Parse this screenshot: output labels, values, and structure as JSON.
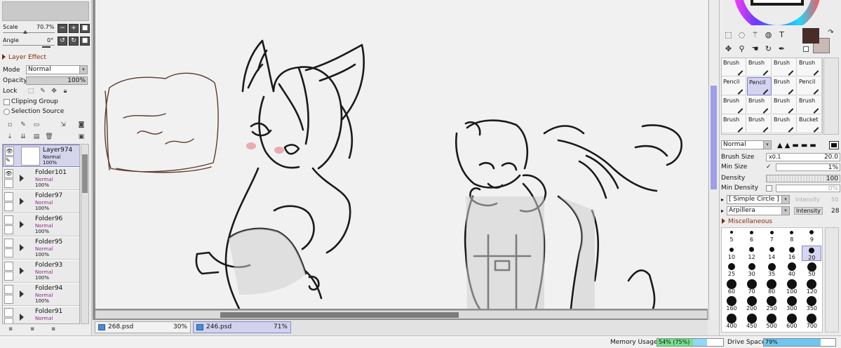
{
  "navigator": {
    "scale_label": "Scale",
    "scale_value": "70.7%",
    "angle_label": "Angle",
    "angle_value": "0°",
    "zoom_out_btn": "−",
    "zoom_in_btn": "+",
    "reset_btn": "■",
    "rotate_left_btn": "↺",
    "rotate_right_btn": "↻",
    "rotate_reset_btn": "■"
  },
  "layer_effect": {
    "title": "Layer Effect",
    "mode_label": "Mode",
    "mode_value": "Normal",
    "opacity_label": "Opacity",
    "opacity_value": "100%",
    "lock_label": "Lock",
    "clipping_label": "Clipping Group",
    "selection_label": "Selection Source"
  },
  "layers": [
    {
      "name": "Layer974",
      "mode": "Normal",
      "opacity": "100%",
      "visible": true,
      "selected": true,
      "folder": false
    },
    {
      "name": "Folder101",
      "mode": "Normal",
      "opacity": "100%",
      "visible": true,
      "selected": false,
      "folder": true
    },
    {
      "name": "Folder97",
      "mode": "Normal",
      "opacity": "100%",
      "visible": false,
      "selected": false,
      "folder": true
    },
    {
      "name": "Folder96",
      "mode": "Normal",
      "opacity": "100%",
      "visible": false,
      "selected": false,
      "folder": true
    },
    {
      "name": "Folder95",
      "mode": "Normal",
      "opacity": "100%",
      "visible": false,
      "selected": false,
      "folder": true
    },
    {
      "name": "Folder93",
      "mode": "Normal",
      "opacity": "100%",
      "visible": false,
      "selected": false,
      "folder": true
    },
    {
      "name": "Folder94",
      "mode": "Normal",
      "opacity": "100%",
      "visible": false,
      "selected": false,
      "folder": true
    },
    {
      "name": "Folder91",
      "mode": "Normal",
      "opacity": "",
      "visible": false,
      "selected": false,
      "folder": true
    }
  ],
  "file_tabs": [
    {
      "name": "268.psd",
      "zoom": "30%",
      "active": false
    },
    {
      "name": "246.psd",
      "zoom": "71%",
      "active": true
    }
  ],
  "colors": {
    "primary": "#4a2c26",
    "secondary": "#c9b8b4",
    "selection_accent": "#9e9ee8"
  },
  "brushes": [
    [
      "Brush",
      "Brush",
      "Brush",
      "Brush"
    ],
    [
      "Pencil",
      "Pencil",
      "Brush",
      "Pencil"
    ],
    [
      "Brush",
      "Brush",
      "Brush",
      "Brush"
    ],
    [
      "Brush",
      "Brush",
      "Brush",
      "Bucket"
    ]
  ],
  "brush_selected_index": [
    1,
    1
  ],
  "brush_props": {
    "blend_mode": "Normal",
    "size_label": "Brush Size",
    "size_mult": "x0.1",
    "size_value": "20.0",
    "min_size_label": "Min Size",
    "min_size_value": "1%",
    "density_label": "Density",
    "density_value": "100",
    "min_density_label": "Min Density",
    "min_density_value": "0%",
    "shape_value": "[ Simple Circle ]",
    "shape_intensity_label": "Intensity",
    "shape_intensity_value": "50",
    "texture_value": "Arpillera",
    "texture_intensity_label": "Intensity",
    "texture_intensity_value": "28",
    "misc_label": "Miscellaneous"
  },
  "brush_sizes": [
    "5",
    "6",
    "7",
    "8",
    "9",
    "10",
    "12",
    "14",
    "16",
    "20",
    "25",
    "30",
    "35",
    "40",
    "50",
    "60",
    "70",
    "80",
    "100",
    "120",
    "160",
    "200",
    "250",
    "300",
    "350",
    "400",
    "450",
    "500",
    "600",
    "700"
  ],
  "brush_size_selected": "20",
  "status": {
    "memory_label": "Memory Usage",
    "memory_value": "54% (75%)",
    "memory_fill": 0.54,
    "memory_peak": 0.75,
    "drive_label": "Drive Space",
    "drive_value": "79%",
    "drive_fill": 0.79
  }
}
